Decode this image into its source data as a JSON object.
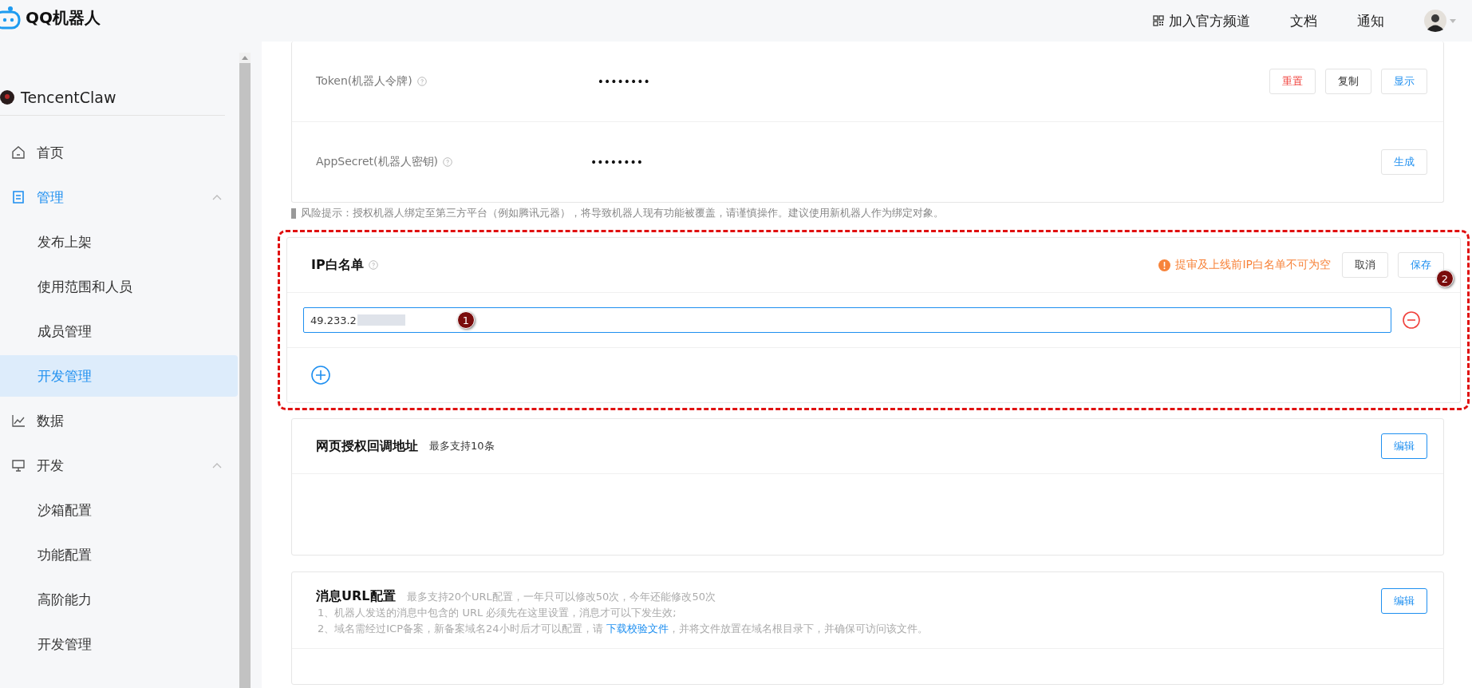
{
  "header": {
    "logo": "QQ机器人",
    "links": [
      {
        "label": "加入官方频道"
      },
      {
        "label": "文档"
      },
      {
        "label": "通知"
      }
    ]
  },
  "sidebar": {
    "bot_name": "TencentClaw",
    "items": [
      {
        "label": "首页",
        "selected": false
      },
      {
        "label": "管理",
        "selected": false,
        "expanded": true,
        "children": [
          {
            "label": "发布上架",
            "selected": false
          },
          {
            "label": "使用范围和人员",
            "selected": false
          },
          {
            "label": "成员管理",
            "selected": false
          },
          {
            "label": "开发管理",
            "selected": true
          }
        ]
      },
      {
        "label": "数据",
        "selected": false
      },
      {
        "label": "开发",
        "selected": false,
        "expanded": true,
        "children": [
          {
            "label": "沙箱配置",
            "selected": false
          },
          {
            "label": "功能配置",
            "selected": false
          },
          {
            "label": "高阶能力",
            "selected": false
          },
          {
            "label": "开发管理",
            "selected": false
          }
        ]
      }
    ]
  },
  "credentials": [
    {
      "label": "Token(机器人令牌)",
      "value": "••••••••",
      "buttons": [
        {
          "label": "重置",
          "kind": "danger"
        },
        {
          "label": "复制",
          "kind": "default"
        },
        {
          "label": "显示",
          "kind": "primary"
        }
      ]
    },
    {
      "label": "AppSecret(机器人密钥)",
      "value": "••••••••",
      "buttons": [
        {
          "label": "生成",
          "kind": "primary"
        }
      ]
    }
  ],
  "risk_note": "风险提示：授权机器人绑定至第三方平台（例如腾讯元器），将导致机器人现有功能被覆盖，请谨慎操作。建议使用新机器人作为绑定对象。",
  "ip_whitelist": {
    "title": "IP白名单",
    "warning": "提审及上线前IP白名单不可为空",
    "buttons": [
      {
        "label": "取消",
        "kind": "default"
      },
      {
        "label": "保存",
        "kind": "primary"
      }
    ],
    "entries": [
      {
        "value": "49.233.2"
      }
    ]
  },
  "callback": {
    "title": "网页授权回调地址",
    "note": "最多支持10条",
    "button": "编辑"
  },
  "message_url": {
    "title": "消息URL配置",
    "note": "最多支持20个URL配置，一年只可以修改50次，今年还能修改50次",
    "button": "编辑",
    "lines": [
      {
        "text": "1、机器人发送的消息中包含的 URL 必须先在这里设置，消息才可以下发生效;"
      },
      {
        "text": "2、域名需经过ICP备案，新备案域名24小时后才可以配置，请 ",
        "link": "下载校验文件",
        "after": "，并将文件放置在域名根目录下，并确保可访问该文件。"
      }
    ]
  },
  "annotations": [
    {
      "label": "1"
    },
    {
      "label": "2"
    }
  ]
}
